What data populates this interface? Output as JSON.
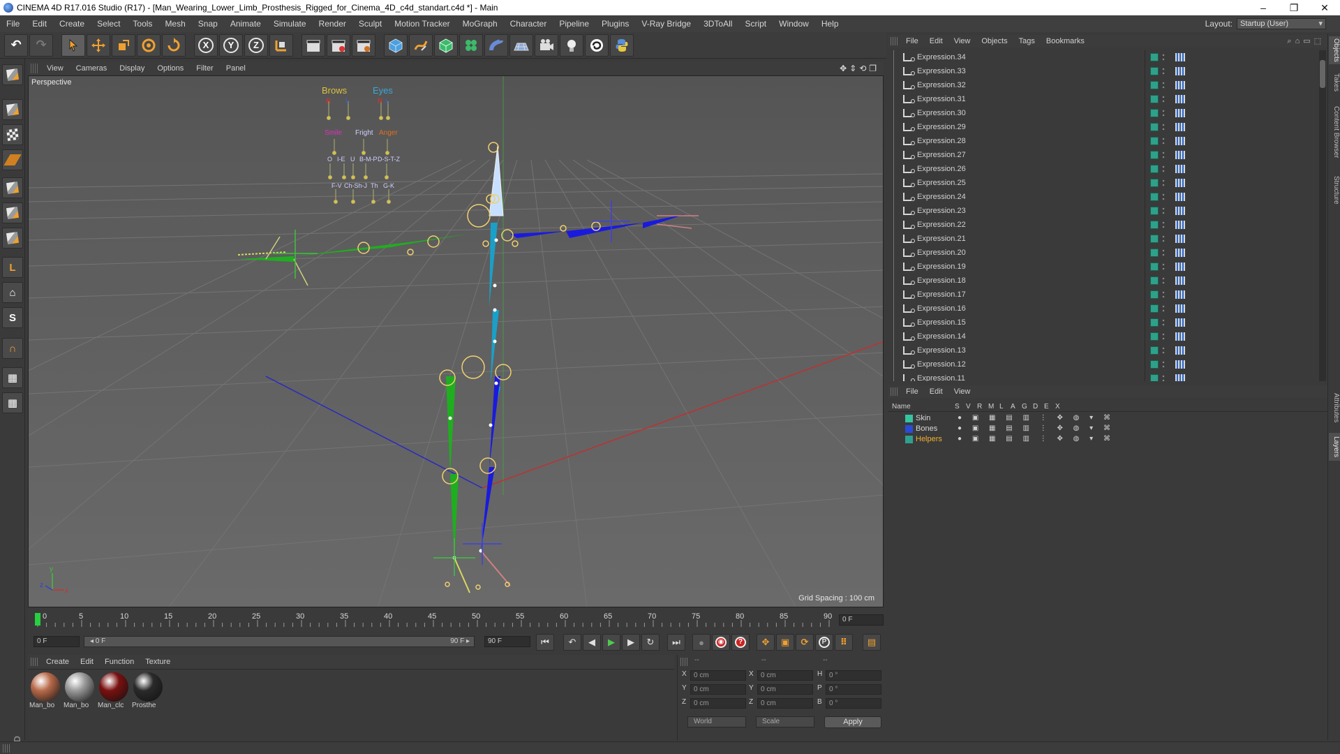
{
  "window": {
    "title": "CINEMA 4D R17.016 Studio (R17) - [Man_Wearing_Lower_Limb_Prosthesis_Rigged_for_Cinema_4D_c4d_standart.c4d *] - Main",
    "minimize": "–",
    "maximize": "❐",
    "close": "✕"
  },
  "menubar": {
    "items": [
      "File",
      "Edit",
      "Create",
      "Select",
      "Tools",
      "Mesh",
      "Snap",
      "Animate",
      "Simulate",
      "Render",
      "Sculpt",
      "Motion Tracker",
      "MoGraph",
      "Character",
      "Pipeline",
      "Plugins",
      "V-Ray Bridge",
      "3DToAll",
      "Script",
      "Window",
      "Help"
    ],
    "layout_label": "Layout:",
    "layout_value": "Startup (User)"
  },
  "toolbar": {
    "undo": "↶",
    "redo": "↷",
    "axis_x": "X",
    "axis_y": "Y",
    "axis_z": "Z"
  },
  "viewport": {
    "menu": [
      "View",
      "Cameras",
      "Display",
      "Options",
      "Filter",
      "Panel"
    ],
    "nav_icons": "✥⇕⟲❐",
    "label": "Perspective",
    "grid_spacing": "Grid Spacing : 100 cm",
    "face_labels": {
      "brows": "Brows",
      "eyes": "Eyes",
      "r1": "R",
      "l1": "L",
      "r2": "R",
      "l2": "L",
      "smile": "Smile",
      "fright": "Fright",
      "anger": "Anger",
      "row1": [
        "O",
        "I-E",
        "U",
        "B-M-P",
        "D-S-T-Z"
      ],
      "row2": [
        "F-V",
        "Ch-Sh-J",
        "Th",
        "G-K"
      ]
    },
    "axis_y_label": "y",
    "axis_x_label": "x",
    "axis_z_label": "z"
  },
  "timeline": {
    "ticks": [
      "0",
      "5",
      "10",
      "15",
      "20",
      "25",
      "30",
      "35",
      "40",
      "45",
      "50",
      "55",
      "60",
      "65",
      "70",
      "75",
      "80",
      "85",
      "90"
    ],
    "current_frame": "0 F"
  },
  "animbar": {
    "start": "0 F",
    "range_start": "◂ 0 F",
    "range_end": "90 F ▸",
    "end": "90 F",
    "btn_first": "⏮",
    "btn_prevkey": "↶",
    "btn_prev": "◀",
    "btn_play": "▶",
    "btn_next": "▶",
    "btn_loop": "↻",
    "btn_last": "⏭",
    "btn_key": "●",
    "btn_record": "◉",
    "btn_help": "?",
    "btn_move": "✥",
    "btn_scale": "▣",
    "btn_rotate": "⟳",
    "btn_param": "P",
    "btn_pla": "⠿",
    "btn_timeline": "▤"
  },
  "materials": {
    "menu": [
      "Create",
      "Edit",
      "Function",
      "Texture"
    ],
    "items": [
      {
        "label": "Man_bo",
        "color": "#b86a4a"
      },
      {
        "label": "Man_bo",
        "color": "#9a9a9a"
      },
      {
        "label": "Man_clc",
        "color": "#7a1010"
      },
      {
        "label": "Prosthe",
        "color": "#2a2a2a"
      }
    ]
  },
  "coords": {
    "header": [
      "--",
      "--",
      "--"
    ],
    "rows": [
      {
        "a": "X",
        "av": "0 cm",
        "b": "X",
        "bv": "0 cm",
        "c": "H",
        "cv": "0 °"
      },
      {
        "a": "Y",
        "av": "0 cm",
        "b": "Y",
        "bv": "0 cm",
        "c": "P",
        "cv": "0 °"
      },
      {
        "a": "Z",
        "av": "0 cm",
        "b": "Z",
        "bv": "0 cm",
        "c": "B",
        "cv": "0 °"
      }
    ],
    "world": "World",
    "scale": "Scale",
    "apply": "Apply"
  },
  "object_manager": {
    "menu": [
      "File",
      "Edit",
      "View",
      "Objects",
      "Tags",
      "Bookmarks"
    ],
    "icons": "⌕⌂▭⬚",
    "items": [
      "Expression.34",
      "Expression.33",
      "Expression.32",
      "Expression.31",
      "Expression.30",
      "Expression.29",
      "Expression.28",
      "Expression.27",
      "Expression.26",
      "Expression.25",
      "Expression.24",
      "Expression.23",
      "Expression.22",
      "Expression.21",
      "Expression.20",
      "Expression.19",
      "Expression.18",
      "Expression.17",
      "Expression.16",
      "Expression.15",
      "Expression.14",
      "Expression.13",
      "Expression.12",
      "Expression.11"
    ]
  },
  "layer_manager": {
    "menu": [
      "File",
      "Edit",
      "View"
    ],
    "columns": [
      "Name",
      "S",
      "V",
      "R",
      "M",
      "L",
      "A",
      "G",
      "D",
      "E",
      "X"
    ],
    "layers": [
      {
        "name": "Skin",
        "color": "#35c4a0",
        "icons": "● ▣ ▦ ▤ ▥ ⋮ ✥ ◍ ▾ ⌘"
      },
      {
        "name": "Bones",
        "color": "#2a4ad8",
        "icons": "● ▣ ▦ ▤ ▥ ⋮ ✥ ◍ ▾ ⌘"
      },
      {
        "name": "Helpers",
        "color": "#2fa090",
        "icons": "● ▣ ▦ ▤ ▥ ⋮ ✥ ◍ ▾ ⌘"
      }
    ]
  },
  "right_tabs": [
    "Objects",
    "Takes",
    "Content Browser",
    "Structure",
    "Attributes",
    "Layers"
  ],
  "maxon": "MAXON CINEMA 4D",
  "colors": {
    "bone_green": "#1fae1f",
    "bone_blue": "#1a1adf",
    "joint": "#f0d070"
  }
}
